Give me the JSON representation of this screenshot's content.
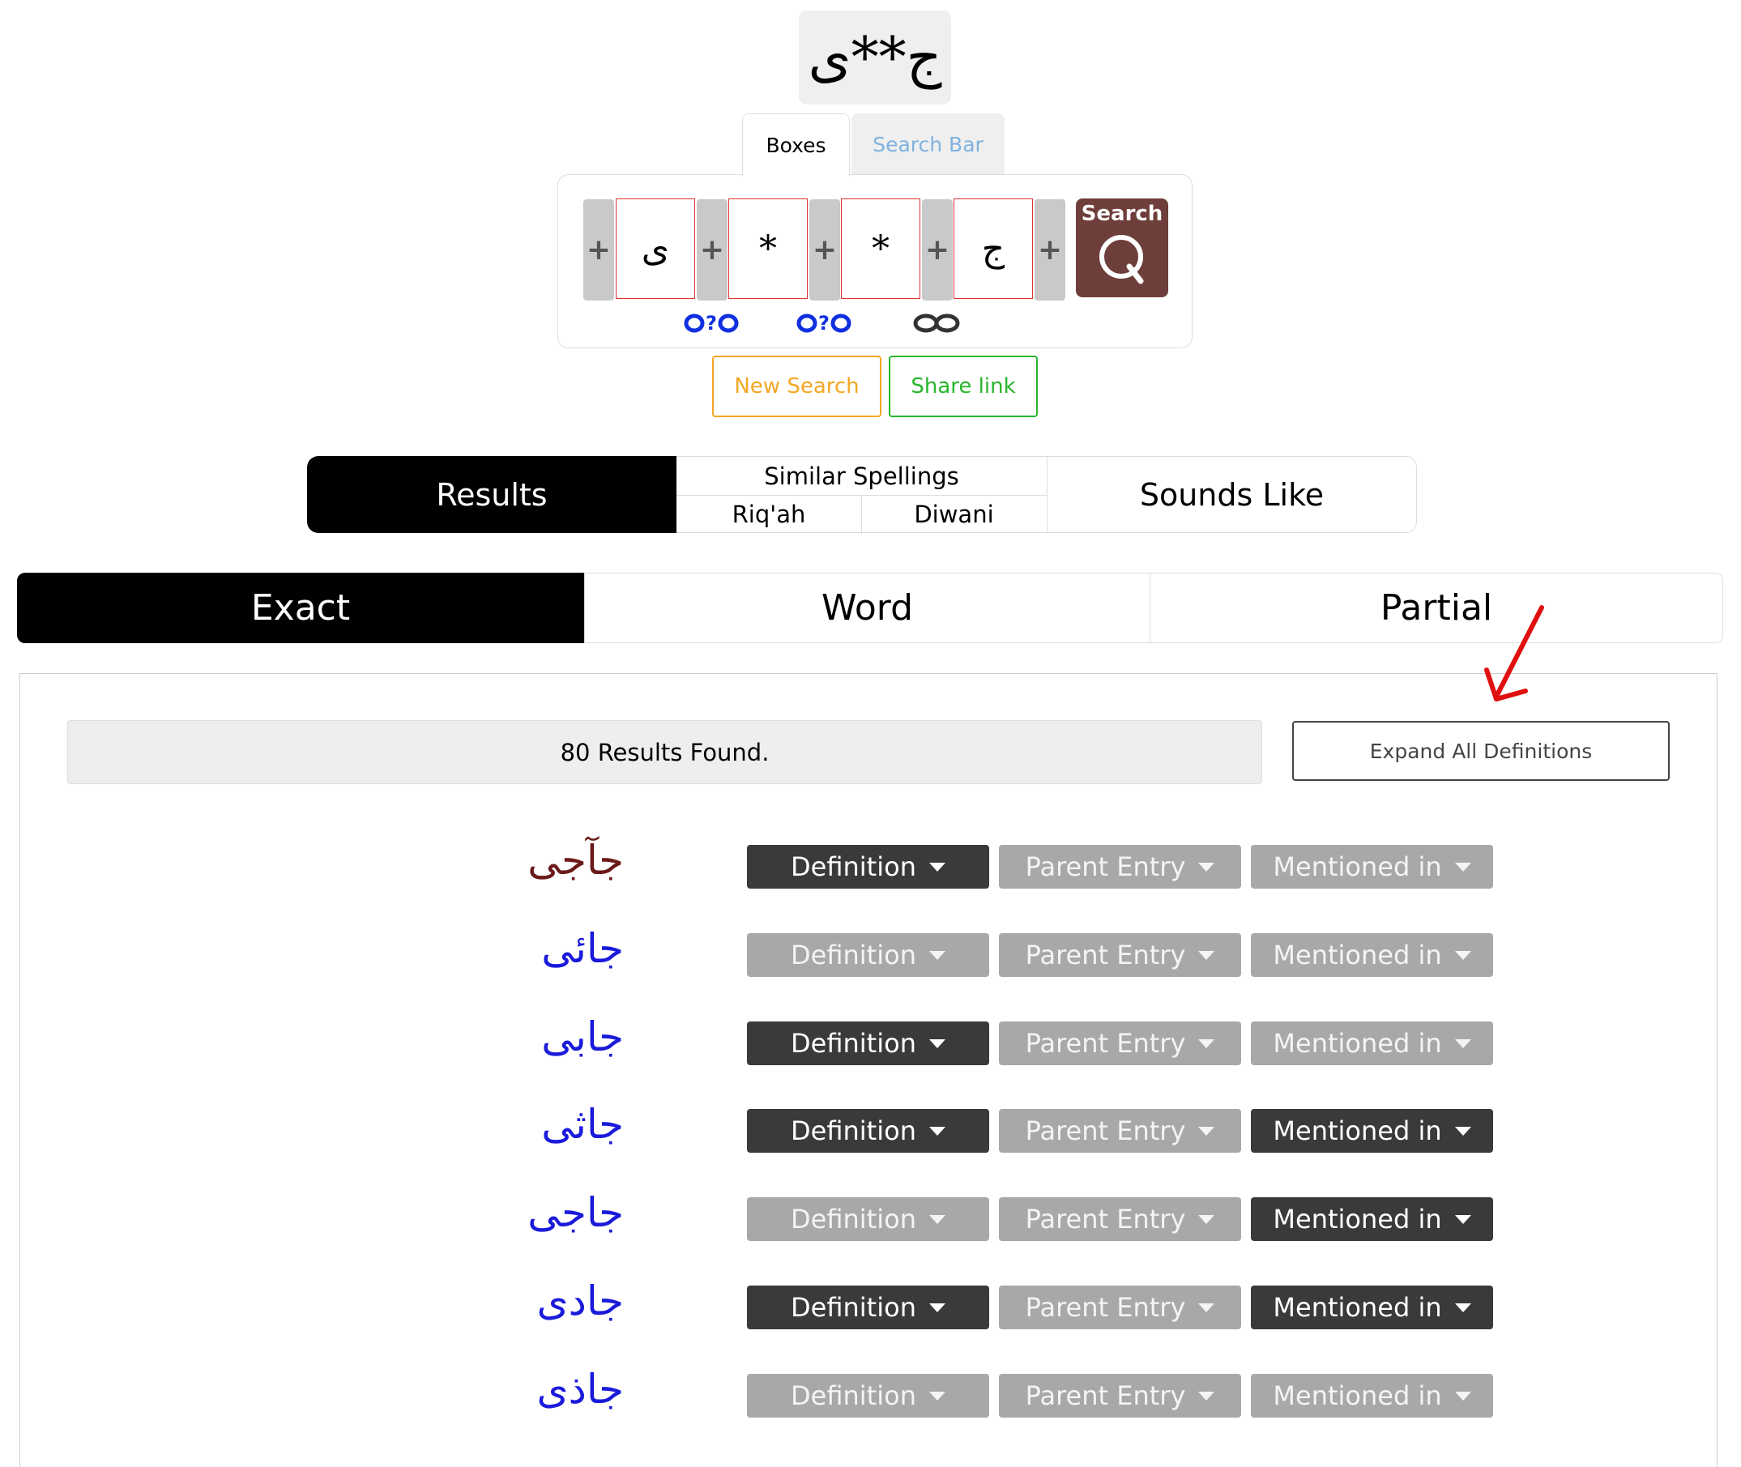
{
  "query": {
    "pattern": "ج**ی"
  },
  "input_tabs": {
    "boxes": "Boxes",
    "search_bar": "Search Bar"
  },
  "boxes": [
    "ی",
    "*",
    "*",
    "ج"
  ],
  "plus_label": "+",
  "search_button": {
    "label": "Search"
  },
  "actions": {
    "new_search": "New Search",
    "share_link": "Share link"
  },
  "result_modes": {
    "results": "Results",
    "similar_spellings": "Similar Spellings",
    "riqah": "Riq'ah",
    "diwani": "Diwani",
    "sounds_like": "Sounds Like"
  },
  "match_tabs": {
    "exact": "Exact",
    "word": "Word",
    "partial": "Partial"
  },
  "results_count": "80 Results Found.",
  "expand_all": "Expand All Definitions",
  "colors": {
    "brown": "#6b1a1a",
    "blue": "#1a1adb",
    "dark": "#3a3a3a",
    "light": "#a8a8a8",
    "search_btn": "#6e3e3a"
  },
  "results": [
    {
      "word": "جآجی",
      "color": "brown",
      "definition": "Definition",
      "parent": "Parent Entry",
      "mentioned": "Mentioned in",
      "def_active": true,
      "parent_active": false,
      "mentioned_active": false
    },
    {
      "word": "جائی",
      "color": "blue",
      "definition": "Definition",
      "parent": "Parent Entry",
      "mentioned": "Mentioned in",
      "def_active": false,
      "parent_active": false,
      "mentioned_active": false
    },
    {
      "word": "جابی",
      "color": "blue",
      "definition": "Definition",
      "parent": "Parent Entry",
      "mentioned": "Mentioned in",
      "def_active": true,
      "parent_active": false,
      "mentioned_active": false
    },
    {
      "word": "جاثی",
      "color": "blue",
      "definition": "Definition",
      "parent": "Parent Entry",
      "mentioned": "Mentioned in",
      "def_active": true,
      "parent_active": false,
      "mentioned_active": true
    },
    {
      "word": "جاجی",
      "color": "blue",
      "definition": "Definition",
      "parent": "Parent Entry",
      "mentioned": "Mentioned in",
      "def_active": false,
      "parent_active": false,
      "mentioned_active": true
    },
    {
      "word": "جادی",
      "color": "blue",
      "definition": "Definition",
      "parent": "Parent Entry",
      "mentioned": "Mentioned in",
      "def_active": true,
      "parent_active": false,
      "mentioned_active": true
    },
    {
      "word": "جاذی",
      "color": "blue",
      "definition": "Definition",
      "parent": "Parent Entry",
      "mentioned": "Mentioned in",
      "def_active": false,
      "parent_active": false,
      "mentioned_active": false
    }
  ]
}
